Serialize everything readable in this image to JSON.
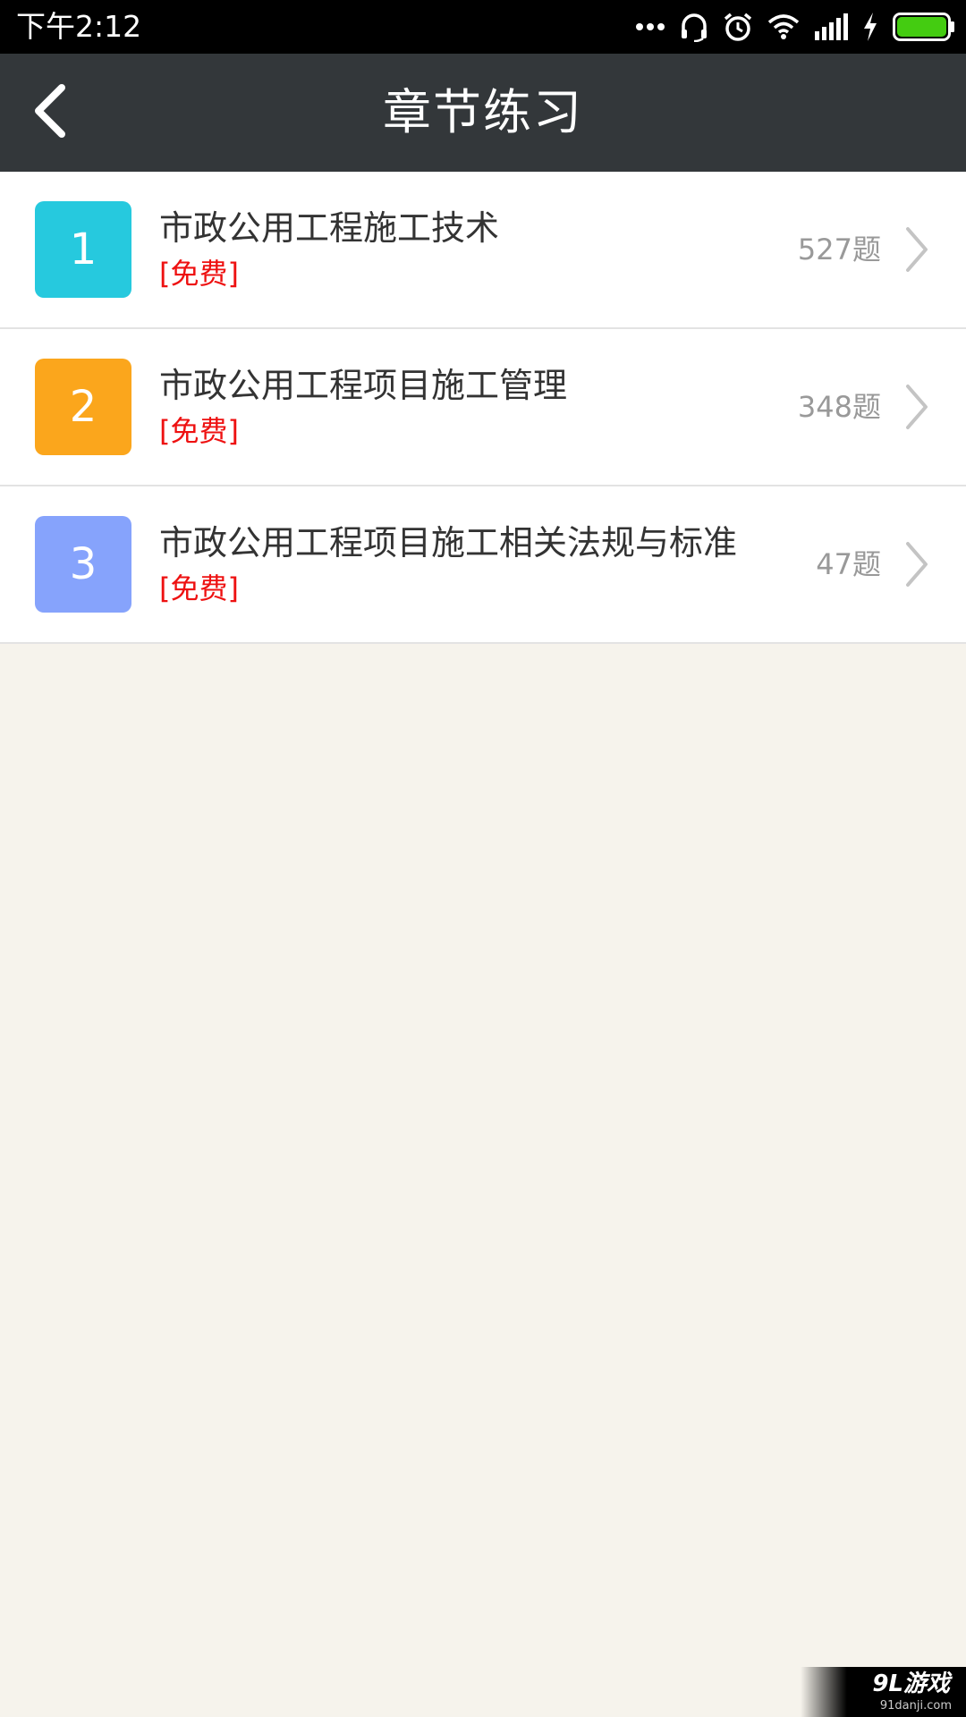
{
  "status_bar": {
    "time": "下午2:12",
    "icons": [
      "more-dots-icon",
      "headset-icon",
      "alarm-clock-icon",
      "wifi-icon",
      "signal-icon",
      "charging-bolt-icon",
      "battery-icon"
    ],
    "battery_color": "#44cc11"
  },
  "header": {
    "title": "章节练习",
    "back_icon": "chevron-left-icon"
  },
  "chapters": [
    {
      "number": "1",
      "title": "市政公用工程施工技术",
      "tag": "[免费]",
      "count": "527题",
      "color": "#26c9de"
    },
    {
      "number": "2",
      "title": "市政公用工程项目施工管理",
      "tag": "[免费]",
      "count": "348题",
      "color": "#fba61c"
    },
    {
      "number": "3",
      "title": "市政公用工程项目施工相关法规与标准",
      "tag": "[免费]",
      "count": "47题",
      "color": "#86a3fc"
    }
  ],
  "colors": {
    "header_bg": "#33373a",
    "page_bg": "#f6f3ec",
    "tag": "#ee1111",
    "count": "#999999"
  },
  "watermark": {
    "mark": "9L游戏",
    "url": "91danji.com"
  }
}
